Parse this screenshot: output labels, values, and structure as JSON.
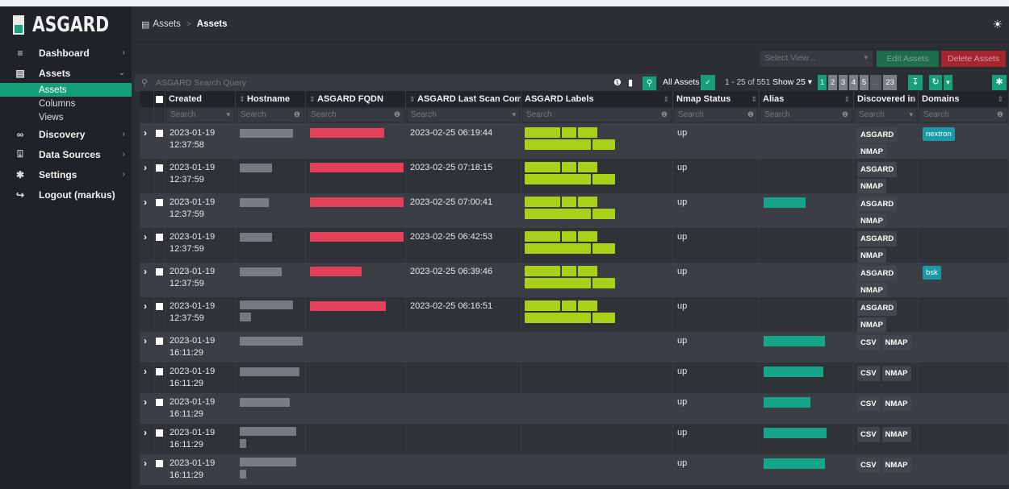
{
  "app": {
    "name": "ASGARD"
  },
  "sidebar": {
    "items": [
      {
        "label": "Dashboard",
        "icon": "dashboard-icon"
      },
      {
        "label": "Assets",
        "icon": "assets-icon"
      },
      {
        "label": "Discovery",
        "icon": "binoculars-icon"
      },
      {
        "label": "Data Sources",
        "icon": "download-icon"
      },
      {
        "label": "Settings",
        "icon": "gear-icon"
      },
      {
        "label": "Logout (markus)",
        "icon": "logout-icon"
      }
    ],
    "assets_sub": [
      "Assets",
      "Columns",
      "Views"
    ]
  },
  "breadcrumb": {
    "parent": "Assets",
    "current": "Assets"
  },
  "toolbar": {
    "select_view_placeholder": "Select View...",
    "edit_label": "Edit Assets",
    "delete_label": "Delete Assets",
    "search_placeholder": "ASGARD Search Query",
    "scope_label": "All Assets",
    "range": "1 - 25 of 551",
    "show_label": "Show 25",
    "pages": [
      "1",
      "2",
      "3",
      "4",
      "5",
      "...",
      "23"
    ]
  },
  "table": {
    "headers": [
      "Created",
      "Hostname",
      "ASGARD FQDN",
      "ASGARD Last Scan Completed",
      "ASGARD Labels",
      "Nmap Status",
      "Alias",
      "Discovered in",
      "Domains"
    ],
    "filter_placeholder": "Search",
    "rows": [
      {
        "date": "2023-01-19",
        "time": "12:37:58",
        "scan": "2023-02-25 06:19:44",
        "nmap": "up",
        "disc": [
          "ASGARD",
          "NMAP"
        ],
        "domain": "nextron"
      },
      {
        "date": "2023-01-19",
        "time": "12:37:59",
        "scan": "2023-02-25 07:18:15",
        "nmap": "up",
        "disc": [
          "ASGARD",
          "NMAP"
        ],
        "domain": ""
      },
      {
        "date": "2023-01-19",
        "time": "12:37:59",
        "scan": "2023-02-25 07:00:41",
        "nmap": "up",
        "disc": [
          "ASGARD",
          "NMAP"
        ],
        "domain": ""
      },
      {
        "date": "2023-01-19",
        "time": "12:37:59",
        "scan": "2023-02-25 06:42:53",
        "nmap": "up",
        "disc": [
          "ASGARD",
          "NMAP"
        ],
        "domain": ""
      },
      {
        "date": "2023-01-19",
        "time": "12:37:59",
        "scan": "2023-02-25 06:39:46",
        "nmap": "up",
        "disc": [
          "ASGARD",
          "NMAP"
        ],
        "domain": "bsk"
      },
      {
        "date": "2023-01-19",
        "time": "12:37:59",
        "scan": "2023-02-25 06:16:51",
        "nmap": "up",
        "disc": [
          "ASGARD",
          "NMAP"
        ],
        "domain": ""
      },
      {
        "date": "2023-01-19",
        "time": "16:11:29",
        "scan": "",
        "nmap": "up",
        "disc": [
          "CSV",
          "NMAP"
        ],
        "domain": ""
      },
      {
        "date": "2023-01-19",
        "time": "16:11:29",
        "scan": "",
        "nmap": "up",
        "disc": [
          "CSV",
          "NMAP"
        ],
        "domain": ""
      },
      {
        "date": "2023-01-19",
        "time": "16:11:29",
        "scan": "",
        "nmap": "up",
        "disc": [
          "CSV",
          "NMAP"
        ],
        "domain": ""
      },
      {
        "date": "2023-01-19",
        "time": "16:11:29",
        "scan": "",
        "nmap": "up",
        "disc": [
          "CSV",
          "NMAP"
        ],
        "domain": ""
      },
      {
        "date": "2023-01-19",
        "time": "16:11:29",
        "scan": "",
        "nmap": "up",
        "disc": [
          "CSV",
          "NMAP"
        ],
        "domain": ""
      }
    ]
  }
}
